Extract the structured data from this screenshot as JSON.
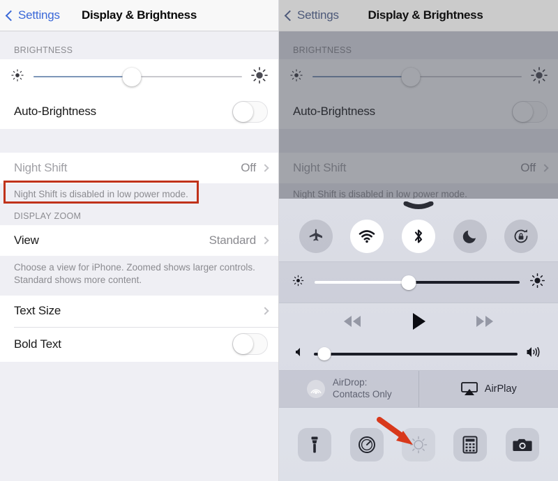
{
  "left_panel": {
    "navbar": {
      "back_label": "Settings",
      "title": "Display & Brightness",
      "back_icon": "chevron-left-icon"
    },
    "sections": [
      {
        "header": "BRIGHTNESS"
      },
      {
        "header": "DISPLAY ZOOM"
      }
    ],
    "brightness": {
      "low_icon": "sun-low-icon",
      "high_icon": "sun-high-icon",
      "value_percent": 47
    },
    "auto_brightness": {
      "label": "Auto-Brightness",
      "state": "off"
    },
    "night_shift": {
      "label": "Night Shift",
      "value": "Off",
      "disabled": true,
      "chevron_icon": "chevron-right-icon"
    },
    "night_shift_note": "Night Shift is disabled in low power mode.",
    "view": {
      "label": "View",
      "value": "Standard",
      "chevron_icon": "chevron-right-icon"
    },
    "view_note": "Choose a view for iPhone. Zoomed shows larger controls. Standard shows more content.",
    "text_size": {
      "label": "Text Size",
      "chevron_icon": "chevron-right-icon"
    },
    "bold_text": {
      "label": "Bold Text",
      "state": "off"
    }
  },
  "right_panel": {
    "navbar": {
      "back_label": "Settings",
      "title": "Display & Brightness",
      "back_icon": "chevron-left-icon"
    },
    "sections": [
      {
        "header": "BRIGHTNESS"
      }
    ],
    "auto_brightness": {
      "label": "Auto-Brightness",
      "state": "off"
    },
    "night_shift": {
      "label": "Night Shift",
      "value": "Off",
      "disabled": true
    },
    "night_shift_note": "Night Shift is disabled in low power mode.",
    "brightness": {
      "value_percent": 47
    },
    "control_center": {
      "grabber_icon": "grabber-chevron-icon",
      "toggles": [
        {
          "name": "airplane-mode",
          "icon": "airplane-icon",
          "state": "off"
        },
        {
          "name": "wifi",
          "icon": "wifi-icon",
          "state": "on"
        },
        {
          "name": "bluetooth",
          "icon": "bluetooth-icon",
          "state": "on"
        },
        {
          "name": "do-not-disturb",
          "icon": "moon-icon",
          "state": "off"
        },
        {
          "name": "rotation-lock",
          "icon": "rotation-lock-icon",
          "state": "off"
        }
      ],
      "brightness": {
        "low_icon": "sun-low-icon",
        "high_icon": "sun-high-icon",
        "value_percent": 46
      },
      "media": {
        "rewind_icon": "rewind-icon",
        "play_icon": "play-icon",
        "forward_icon": "fast-forward-icon",
        "rewind_state": "disabled",
        "forward_state": "disabled",
        "volume_percent": 5,
        "volume_low_icon": "speaker-mute-icon",
        "volume_high_icon": "speaker-loud-icon"
      },
      "airdrop": {
        "icon": "airdrop-icon",
        "line1": "AirDrop:",
        "line2": "Contacts Only"
      },
      "airplay": {
        "icon": "airplay-icon",
        "label": "AirPlay"
      },
      "shortcuts": [
        {
          "name": "flashlight",
          "icon": "flashlight-icon",
          "state": "enabled"
        },
        {
          "name": "timer",
          "icon": "timer-icon",
          "state": "enabled"
        },
        {
          "name": "night-shift",
          "icon": "night-shift-icon",
          "state": "disabled"
        },
        {
          "name": "calculator",
          "icon": "calculator-icon",
          "state": "enabled"
        },
        {
          "name": "camera",
          "icon": "camera-icon",
          "state": "enabled"
        }
      ]
    }
  },
  "annotations": {
    "highlight_color": "#c0321a",
    "box_target": "night-shift-note",
    "arrow_target": "night-shift-shortcut"
  }
}
